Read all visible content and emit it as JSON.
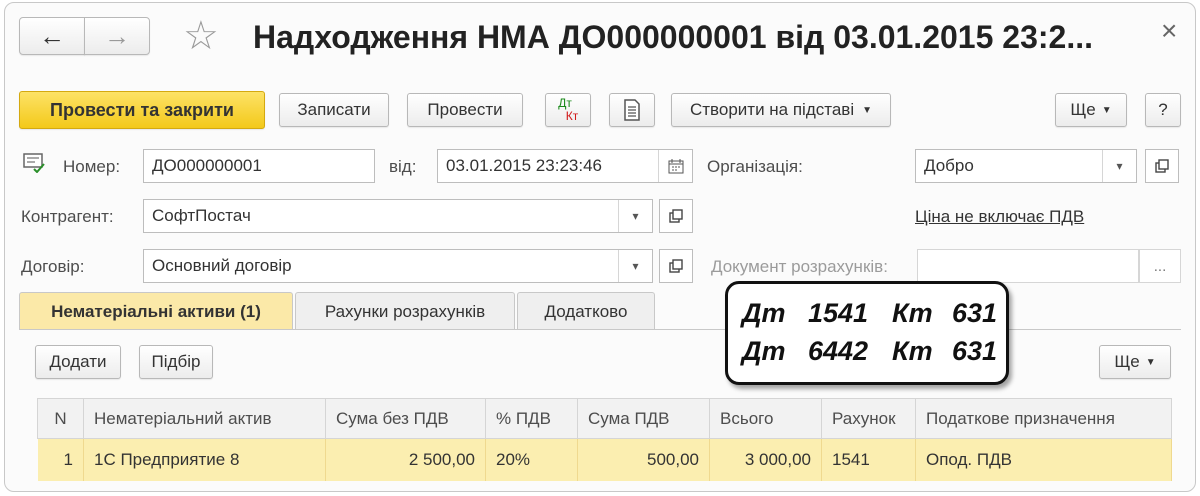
{
  "window": {
    "title": "Надходження НМА ДО000000001 від 03.01.2015 23:2...",
    "close_glyph": "×"
  },
  "nav": {
    "back_glyph": "←",
    "forward_glyph": "→",
    "favorite_glyph": "☆"
  },
  "toolbar": {
    "post_and_close": "Провести та закрити",
    "save": "Записати",
    "post": "Провести",
    "dt_label": "Дт",
    "kt_label": "Кт",
    "create_based_on": "Створити на підставі",
    "more": "Ще",
    "help": "?"
  },
  "form": {
    "number_label": "Номер:",
    "number_value": "ДО000000001",
    "date_label": "від:",
    "date_value": "03.01.2015 23:23:46",
    "org_label": "Організація:",
    "org_value": "Добро",
    "contractor_label": "Контрагент:",
    "contractor_value": "СофтПостач",
    "vat_link": "Ціна не включає ПДВ",
    "contract_label": "Договір:",
    "contract_value": "Основний договір",
    "settlement_doc_label": "Документ розрахунків:",
    "settlement_doc_value": "",
    "ellipsis": "..."
  },
  "tabs": [
    {
      "label": "Нематеріальні активи (1)",
      "active": true
    },
    {
      "label": "Рахунки розрахунків",
      "active": false
    },
    {
      "label": "Додатково",
      "active": false
    }
  ],
  "table_toolbar": {
    "add": "Додати",
    "pick": "Підбір",
    "more": "Ще"
  },
  "table": {
    "columns": [
      "N",
      "Нематеріальний актив",
      "Сума без ПДВ",
      "% ПДВ",
      "Сума ПДВ",
      "Всього",
      "Рахунок",
      "Податкове призначення"
    ],
    "rows": [
      [
        "1",
        "1С Предприятие 8",
        "2 500,00",
        "20%",
        "500,00",
        "3 000,00",
        "1541",
        "Опод. ПДВ"
      ]
    ]
  },
  "annotation": {
    "lines": [
      {
        "dt": "Дт",
        "dt_acc": "1541",
        "kt": "Кт",
        "kt_acc": "631"
      },
      {
        "dt": "Дт",
        "dt_acc": "6442",
        "kt": "Кт",
        "kt_acc": "631"
      }
    ]
  },
  "colors": {
    "primary_button": "#f3c91a",
    "active_tab": "#fbe9a8",
    "selected_row": "#fbeeb0",
    "link": "#333333"
  }
}
